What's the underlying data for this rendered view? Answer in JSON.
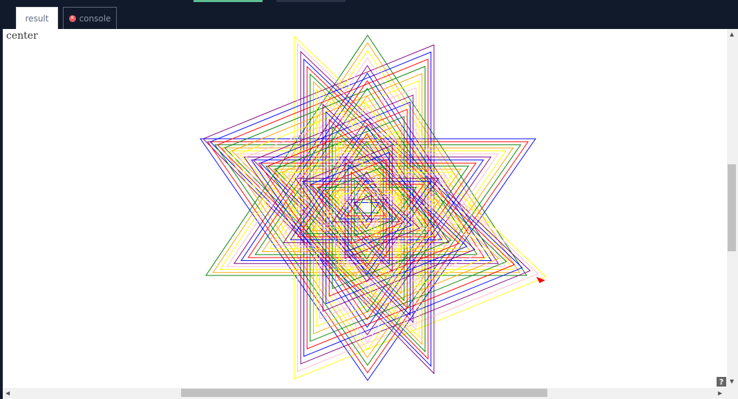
{
  "tabs": {
    "result_label": "result",
    "console_label": "console"
  },
  "canvas": {
    "label": "center"
  },
  "help_label": "?",
  "colors": {
    "sequence": [
      "#0000ff",
      "#ff0000",
      "#008000",
      "#ffa500",
      "#ffff00",
      "#ffc0cb",
      "#800080"
    ],
    "turtle": "#ff0000"
  }
}
